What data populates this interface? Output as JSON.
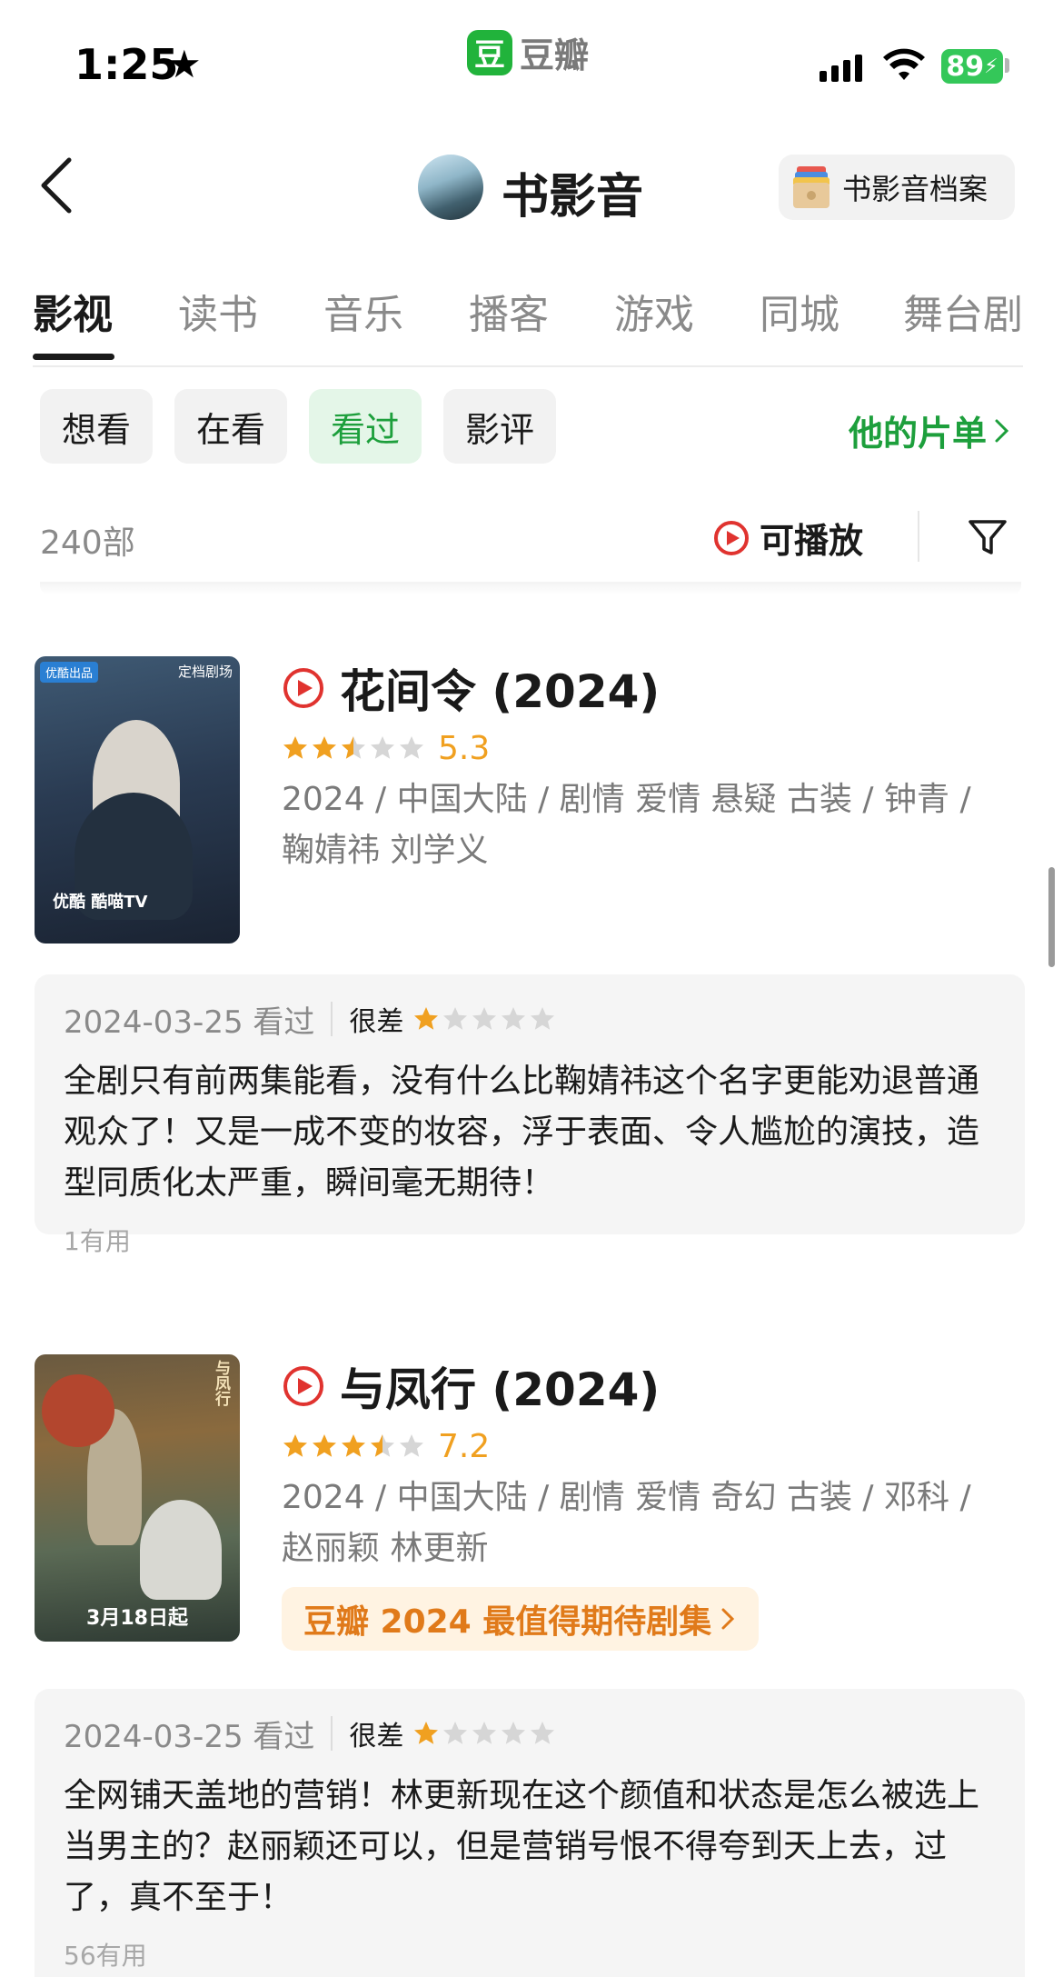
{
  "status_bar": {
    "time": "1:25",
    "app_name": "豆瓣",
    "app_icon_char": "豆",
    "battery": "89"
  },
  "header": {
    "title": "书影音",
    "archive_label": "书影音档案"
  },
  "tabs": [
    {
      "label": "影视",
      "active": true
    },
    {
      "label": "读书",
      "active": false
    },
    {
      "label": "音乐",
      "active": false
    },
    {
      "label": "播客",
      "active": false
    },
    {
      "label": "游戏",
      "active": false
    },
    {
      "label": "同城",
      "active": false
    },
    {
      "label": "舞台剧",
      "active": false
    }
  ],
  "filters": {
    "chips": [
      {
        "label": "想看",
        "active": false
      },
      {
        "label": "在看",
        "active": false
      },
      {
        "label": "看过",
        "active": true
      },
      {
        "label": "影评",
        "active": false
      }
    ],
    "playlist_link": "他的片单"
  },
  "list_meta": {
    "count": "240部",
    "playable_label": "可播放"
  },
  "colors": {
    "brand_green": "#1d9f3c",
    "star_orange": "#f0a020",
    "promo_orange": "#e07a1a"
  },
  "movies": [
    {
      "title": "花间令 (2024)",
      "stars": 2.5,
      "score": "5.3",
      "meta": "2024 / 中国大陆 / 剧情 爱情 悬疑 古装 / 钟青 / 鞠婧祎 刘学义",
      "poster": {
        "tag": "优酷出品",
        "corner": "定档剧场",
        "platform": "优酷  酷喵TV"
      },
      "review": {
        "date": "2024-03-25 看过",
        "grade": "很差",
        "grade_stars": 1,
        "text": "全剧只有前两集能看，没有什么比鞠婧祎这个名字更能劝退普通观众了！又是一成不变的妆容，浮于表面、令人尴尬的演技，造型同质化太严重，瞬间毫无期待！",
        "helpful": "1有用"
      }
    },
    {
      "title": "与凤行 (2024)",
      "stars": 3.5,
      "score": "7.2",
      "meta": "2024 / 中国大陆 / 剧情 爱情 奇幻 古装 / 邓科 / 赵丽颖 林更新",
      "poster": {
        "corner": "与凤行",
        "bottom": "3月18日起"
      },
      "promo": "豆瓣 2024 最值得期待剧集",
      "review": {
        "date": "2024-03-25 看过",
        "grade": "很差",
        "grade_stars": 1,
        "text": "全网铺天盖地的营销！林更新现在这个颜值和状态是怎么被选上当男主的？赵丽颖还可以，但是营销号恨不得夸到天上去，过了，真不至于！",
        "helpful": "56有用"
      }
    }
  ]
}
